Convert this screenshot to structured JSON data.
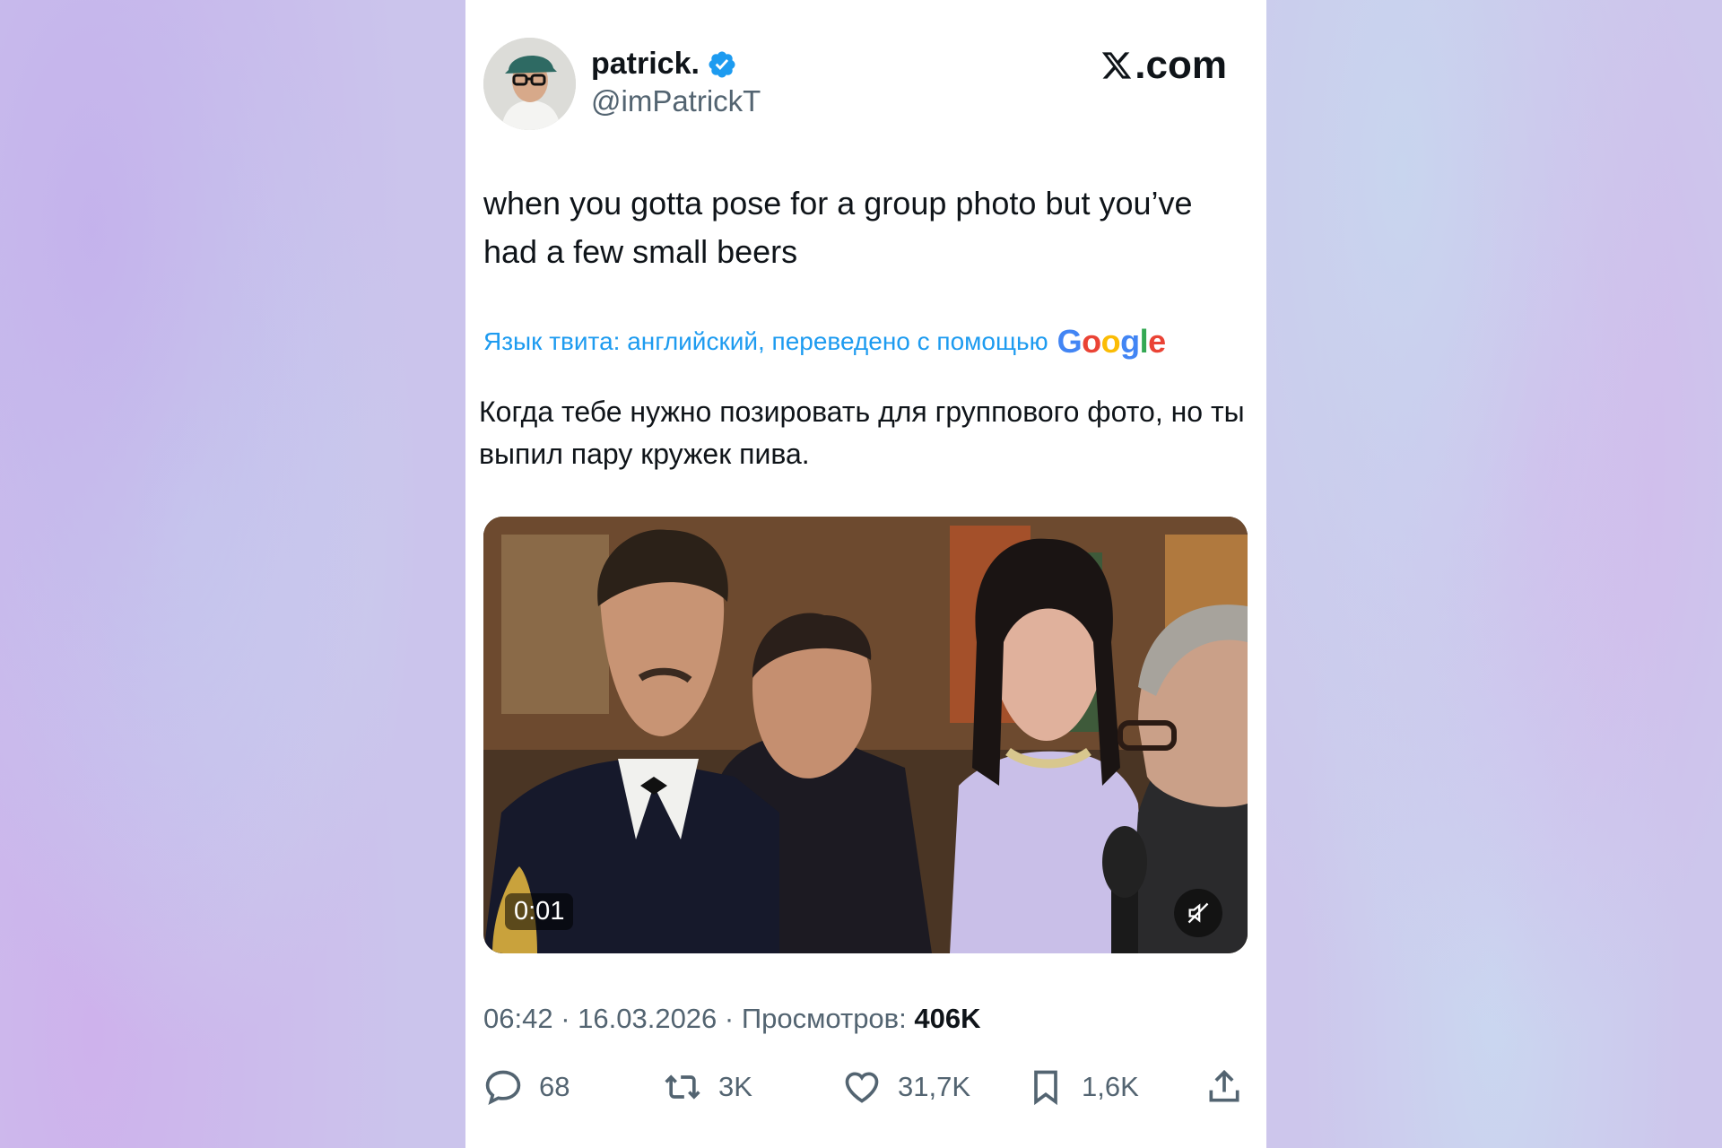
{
  "tweet": {
    "display_name": "patrick.",
    "handle": "@imPatrickT",
    "site": ".com",
    "text": "when you gotta pose for a group photo but you’ve had a few small beers",
    "translation_label": "Язык твита: английский, переведено с помощью",
    "translation_provider": "Google",
    "translated_text": "Когда тебе нужно позировать для группового фото, но ты выпил пару кружек пива.",
    "video_time": "0:01",
    "time": "06:42",
    "date": "16.03.2026",
    "views_label": "Просмотров:",
    "views_count": "406K"
  },
  "actions": {
    "replies": "68",
    "reposts": "3K",
    "likes": "31,7K",
    "bookmarks": "1,6K"
  },
  "colors": {
    "accent": "#1d9bf0",
    "text": "#0f1419",
    "muted": "#536471"
  },
  "icons": [
    "verified-badge-icon",
    "x-logo-icon",
    "reply-icon",
    "repost-icon",
    "like-icon",
    "bookmark-icon",
    "share-icon",
    "mute-icon"
  ]
}
